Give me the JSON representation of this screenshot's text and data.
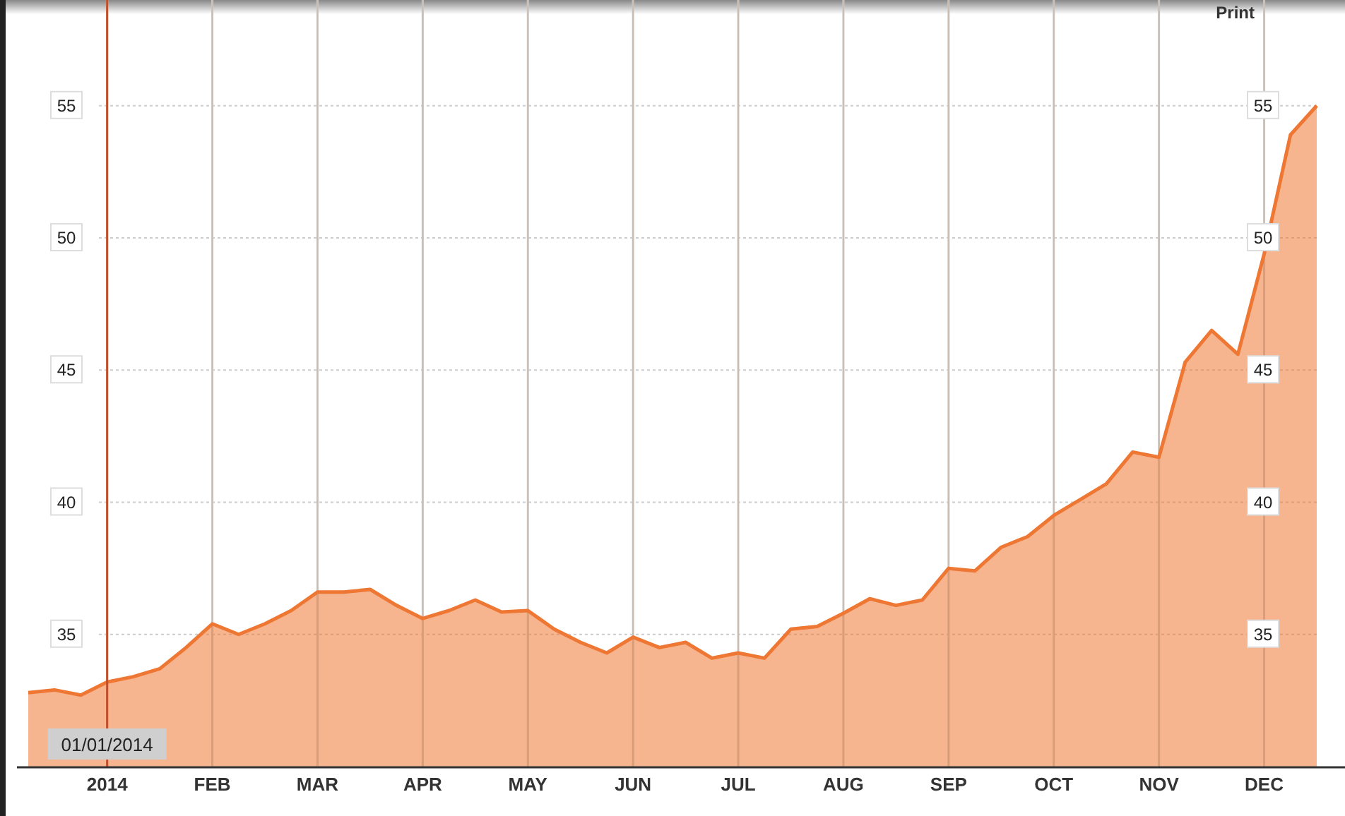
{
  "toolbar": {
    "print": "Print"
  },
  "chart": {
    "left_axis_labels": [
      "55",
      "50",
      "45",
      "40",
      "35"
    ],
    "right_axis_labels": [
      "55",
      "50",
      "45",
      "40",
      "35"
    ],
    "chart_data": {
      "type": "area",
      "ylim": [
        30,
        59
      ],
      "yticks": [
        55,
        50,
        45,
        40,
        35
      ],
      "categories": [
        null,
        null,
        null,
        "2014",
        null,
        null,
        null,
        "FEB",
        null,
        null,
        null,
        "MAR",
        null,
        null,
        null,
        "APR",
        null,
        null,
        null,
        "MAY",
        null,
        null,
        null,
        "JUN",
        null,
        null,
        null,
        "JUL",
        null,
        null,
        null,
        "AUG",
        null,
        null,
        null,
        "SEP",
        null,
        null,
        null,
        "OCT",
        null,
        null,
        null,
        "NOV",
        null,
        null,
        null,
        "DEC",
        null,
        null
      ],
      "series": [
        {
          "color": "#ee7733",
          "values": [
            32.8,
            32.9,
            32.7,
            33.2,
            33.4,
            33.7,
            34.5,
            35.4,
            35.0,
            35.4,
            35.9,
            36.6,
            36.6,
            36.7,
            36.1,
            35.6,
            35.9,
            36.3,
            35.85,
            35.9,
            35.2,
            34.7,
            34.3,
            34.9,
            34.5,
            34.7,
            34.1,
            34.3,
            34.1,
            35.2,
            35.3,
            35.8,
            36.35,
            36.1,
            36.3,
            37.5,
            37.4,
            38.3,
            38.7,
            39.5,
            40.1,
            40.7,
            41.9,
            41.7,
            45.3,
            46.5,
            45.6,
            49.4,
            53.9,
            55.0
          ]
        }
      ],
      "grid": true,
      "annotations": [
        {
          "x": "2014",
          "text": "01/01/2014"
        }
      ]
    }
  }
}
